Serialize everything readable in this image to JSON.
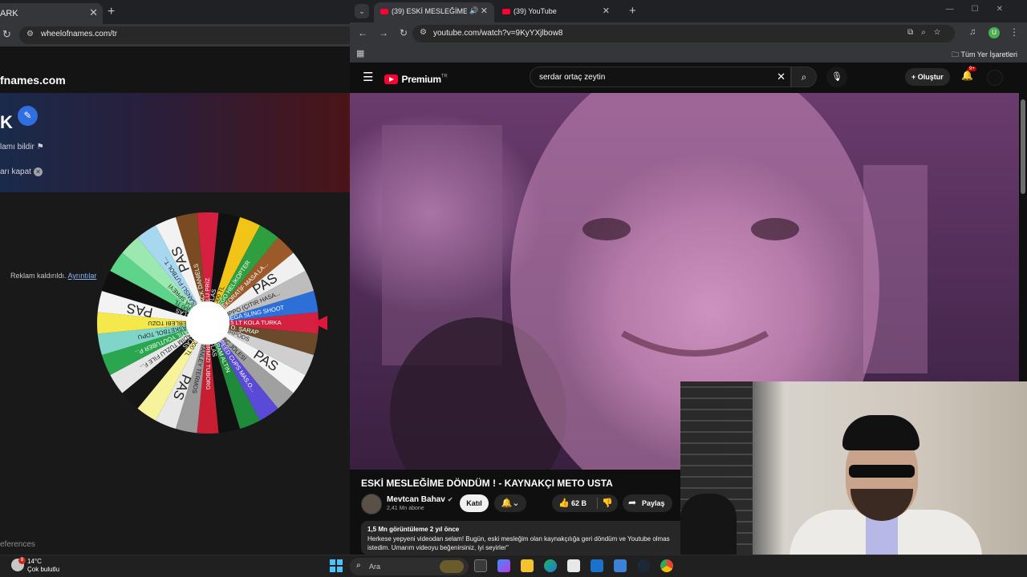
{
  "left_browser": {
    "tab_title": "ARK",
    "url": "wheelofnames.com/tr",
    "site_name": "fnames.com",
    "title_fragment": "K",
    "report_text": "lamı bildir",
    "close_ads_text": "arı kapat",
    "ad_removed_text": "Reklam kaldırıldı.",
    "ad_details_link": "Ayrıntılar",
    "bottom_text": "eferences"
  },
  "wheel": {
    "segments": [
      {
        "label": "3'LÜ PRİZ",
        "color": "#d62040"
      },
      {
        "label": "İFLAS",
        "color": "#111111"
      },
      {
        "label": "1000 TL",
        "color": "#f2c418"
      },
      {
        "label": "LEGO HELİKOPTER",
        "color": "#2e9e3e"
      },
      {
        "label": "DEKORATİF MASA LA...",
        "color": "#9c5a2a"
      },
      {
        "label": "PAS",
        "color": "#f0f0f0"
      },
      {
        "label": "ZIPPO (ÇITIR HASA...",
        "color": "#bdbdbd"
      },
      {
        "label": "MEGA SLİNG SHOOT",
        "color": "#2d6fd8"
      },
      {
        "label": "1.5 LT KOLA TURKA",
        "color": "#d62040"
      },
      {
        "label": "K.O. ŞARAP",
        "color": "#6a4a2a"
      },
      {
        "label": "AİRPODS",
        "color": "#cfcfcf"
      },
      {
        "label": "PAS",
        "color": "#f4f4f4"
      },
      {
        "label": "SAÇ JÖLESİ",
        "color": "#a0a0a0"
      },
      {
        "label": "SPEED CUPS MAS.O...",
        "color": "#5a4ad8"
      },
      {
        "label": "GRAM ALTIN",
        "color": "#1e8a3a"
      },
      {
        "label": "İFLAS",
        "color": "#111111"
      },
      {
        "label": "KIRMIZI TUBORG",
        "color": "#c81e32"
      },
      {
        "label": "STANLEY TERMOS",
        "color": "#9a9a9a"
      },
      {
        "label": "PAS",
        "color": "#e8e8e8"
      },
      {
        "label": "1000 TL",
        "color": "#f6f39a"
      },
      {
        "label": "İFLAS",
        "color": "#151515"
      },
      {
        "label": "TADIM TUZLU FILE F...",
        "color": "#e6e6e6"
      },
      {
        "label": "KATIL YOUTUBER P...",
        "color": "#2aa64e"
      },
      {
        "label": "BASKETBOL TOPU",
        "color": "#7fd6c8"
      },
      {
        "label": "LEBLEBİ TOZU",
        "color": "#f4e84a"
      },
      {
        "label": "PAS",
        "color": "#f3f3f3"
      },
      {
        "label": "İFLAS",
        "color": "#0f0f0f"
      },
      {
        "label": "2000 TL",
        "color": "#5ed38a"
      },
      {
        "label": "ODA SPREYİ",
        "color": "#9be8b0"
      },
      {
        "label": "LİSANSLI FUTBOL T...",
        "color": "#a8d8f0"
      },
      {
        "label": "PAS",
        "color": "#f2f2f2"
      },
      {
        "label": "JACK DANIELS",
        "color": "#7a4a22"
      }
    ]
  },
  "right_browser": {
    "tab1_title": "(39) ESKİ MESLEĞİME DÖNDÜ",
    "tab2_title": "(39) YouTube",
    "url": "youtube.com/watch?v=9KyYXjlbow8",
    "all_bookmarks": "Tüm Yer İşaretleri",
    "avatar_letter": "U"
  },
  "youtube": {
    "logo_word": "Premium",
    "logo_region": "TR",
    "search_query": "serdar ortaç zeytin",
    "create_label": "Oluştur",
    "notif_badge": "9+",
    "video_title": "ESKİ MESLEĞİME DÖNDÜM ! - KAYNAKÇI METO USTA",
    "channel_name": "Mevtcan Bahav",
    "subscribers": "2,41 Mn abone",
    "join_label": "Katıl",
    "like_count": "62 B",
    "share_label": "Paylaş",
    "views_line": "1,5 Mn görüntüleme  2 yıl önce",
    "description": "Herkese yepyeni videodan selam! Bugün, eski mesleğim olan kaynakçılığa geri döndüm ve Youtube olmas istedim. Umarım videoyu beğenirsiniz, iyi seyirler\""
  },
  "taskbar": {
    "temperature": "14°C",
    "condition": "Çok bulutlu",
    "weather_badge": "8",
    "search_label": "Ara"
  },
  "colors": {
    "yt_red": "#ff0033",
    "start_blue": "#4cc2ff",
    "wheel_pointer": "#e0163a"
  }
}
